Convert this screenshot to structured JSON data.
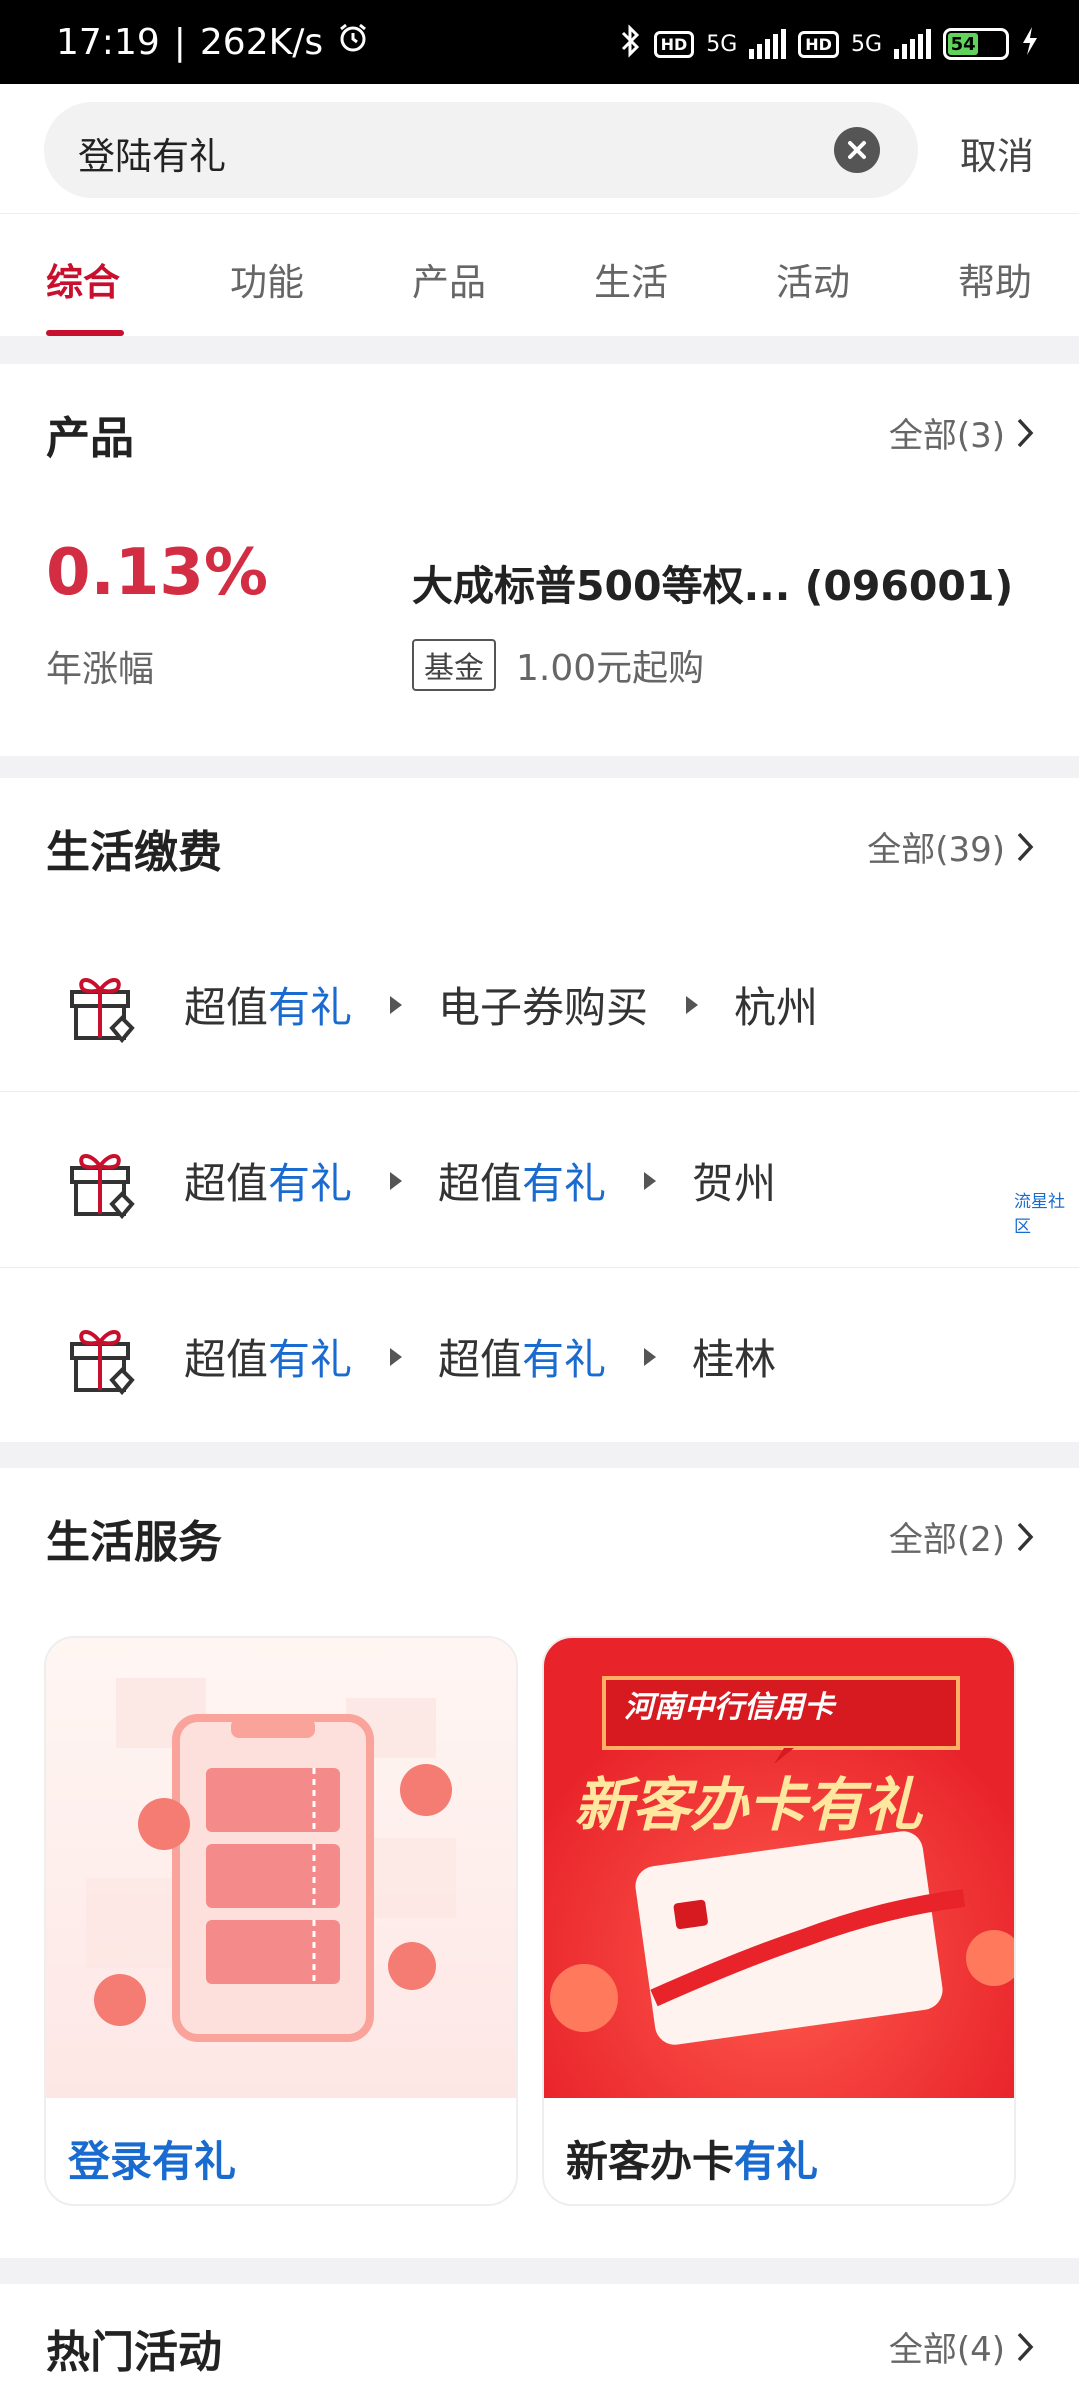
{
  "status_bar": {
    "time": "17:19",
    "speed": "262K/s",
    "net1": "5G",
    "net2": "5G",
    "hd": "HD",
    "battery": "54"
  },
  "search": {
    "query": "登陆有礼",
    "cancel_label": "取消"
  },
  "tabs": [
    {
      "label": "综合",
      "active": true
    },
    {
      "label": "功能"
    },
    {
      "label": "产品"
    },
    {
      "label": "生活"
    },
    {
      "label": "活动"
    },
    {
      "label": "帮助"
    }
  ],
  "products": {
    "title": "产品",
    "all_label": "全部(3)",
    "item": {
      "rate": "0.13%",
      "rate_label": "年涨幅",
      "name": "大成标普500等权...  (096001)",
      "tag": "基金",
      "min_purchase": "1.00元起购"
    }
  },
  "life_payment": {
    "title": "生活缴费",
    "all_label": "全部(39)",
    "rows": [
      {
        "a_pre": "超值",
        "a_hl": "有礼",
        "b_pre": "电子券购买",
        "b_hl": "",
        "city": "杭州"
      },
      {
        "a_pre": "超值",
        "a_hl": "有礼",
        "b_pre": "超值",
        "b_hl": "有礼",
        "city": "贺州"
      },
      {
        "a_pre": "超值",
        "a_hl": "有礼",
        "b_pre": "超值",
        "b_hl": "有礼",
        "city": "桂林"
      }
    ]
  },
  "watermark": "流星社区",
  "life_service": {
    "title": "生活服务",
    "all_label": "全部(2)",
    "cards": [
      {
        "pre": "登录",
        "hl": "有礼",
        "pre_color": "#1a6bd0"
      },
      {
        "pre": "新客办卡",
        "hl": "有礼",
        "banner_top": "河南中行信用卡",
        "banner_main": "新客办卡有礼"
      }
    ]
  },
  "hot_activities": {
    "title": "热门活动",
    "all_label": "全部(4)"
  },
  "colors": {
    "accent": "#c8102e",
    "highlight": "#1a6bd0",
    "rate": "#d22d43"
  }
}
